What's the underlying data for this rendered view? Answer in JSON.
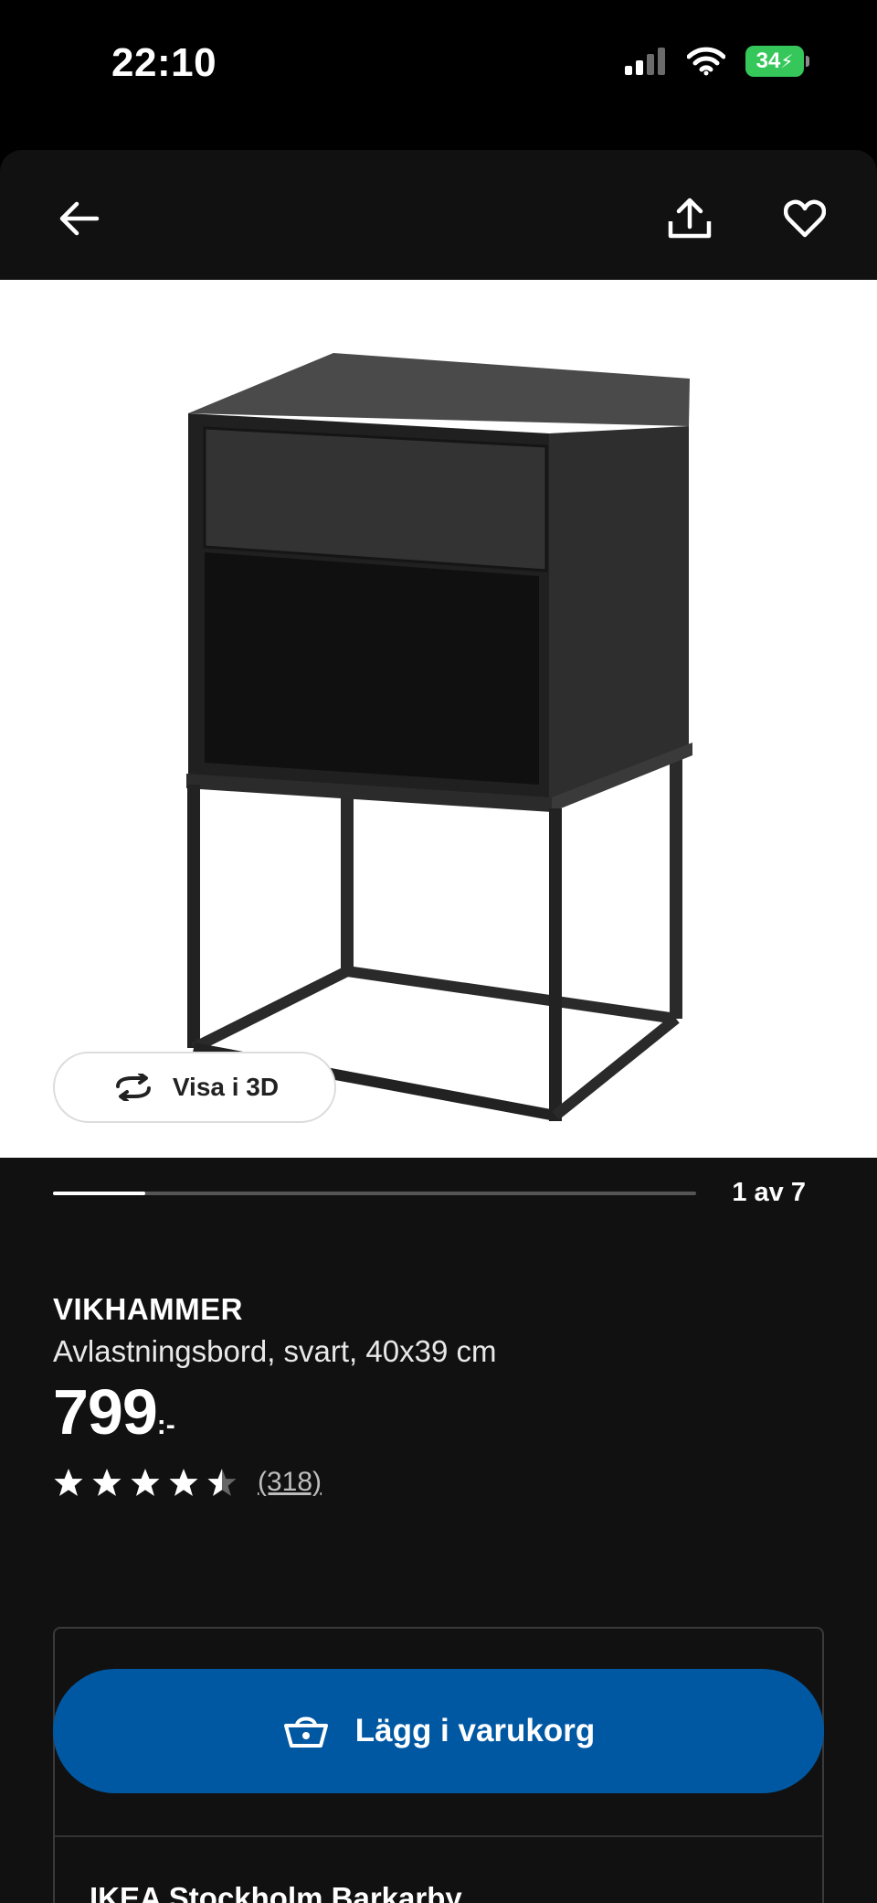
{
  "status_bar": {
    "time": "22:10",
    "battery": "34",
    "icons": [
      "cellular-signal-icon",
      "wifi-icon",
      "battery-charging-icon"
    ]
  },
  "nav": {
    "icons": [
      "arrow-left-icon",
      "share-icon",
      "heart-icon"
    ]
  },
  "gallery": {
    "view_3d_label": "Visa i 3D",
    "page_counter": "1 av 7",
    "current_page": 1,
    "total_pages": 7
  },
  "product": {
    "name": "VIKHAMMER",
    "description": "Avlastningsbord, svart, 40x39 cm",
    "price": "799",
    "price_suffix": ":-",
    "rating": 4.5,
    "rating_max": 5,
    "review_count": "(318)"
  },
  "purchase": {
    "add_to_cart_label": "Lägg i varukorg",
    "store_name": "IKEA Stockholm Barkarby"
  },
  "colors": {
    "background": "#111111",
    "accent_blue": "#0058a3",
    "battery_green": "#36c75a"
  }
}
